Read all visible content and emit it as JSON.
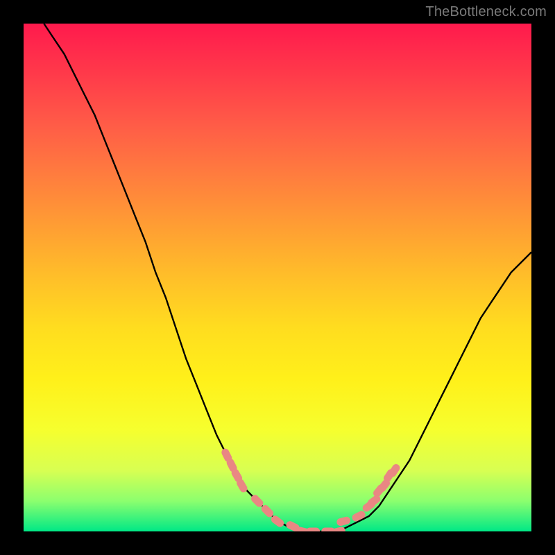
{
  "attribution": "TheBottleneck.com",
  "chart_data": {
    "type": "line",
    "title": "",
    "xlabel": "",
    "ylabel": "",
    "xlim": [
      0,
      100
    ],
    "ylim": [
      0,
      100
    ],
    "grid": false,
    "legend": false,
    "series": [
      {
        "name": "bottleneck-curve",
        "x": [
          4,
          6,
          8,
          10,
          12,
          14,
          16,
          18,
          20,
          22,
          24,
          26,
          28,
          30,
          32,
          34,
          36,
          38,
          40,
          42,
          44,
          46,
          48,
          50,
          52,
          54,
          56,
          58,
          60,
          62,
          64,
          66,
          68,
          70,
          72,
          74,
          76,
          78,
          80,
          82,
          84,
          86,
          88,
          90,
          92,
          94,
          96,
          98,
          100
        ],
        "y": [
          100,
          97,
          94,
          90,
          86,
          82,
          77,
          72,
          67,
          62,
          57,
          51,
          46,
          40,
          34,
          29,
          24,
          19,
          15,
          11,
          8,
          6,
          4,
          2,
          1,
          0,
          0,
          0,
          0,
          0,
          1,
          2,
          3,
          5,
          8,
          11,
          14,
          18,
          22,
          26,
          30,
          34,
          38,
          42,
          45,
          48,
          51,
          53,
          55
        ]
      }
    ],
    "markers": {
      "name": "sample-points",
      "color": "#e98783",
      "x": [
        40,
        41,
        42,
        43,
        46,
        48,
        50,
        53,
        55,
        57,
        60,
        62,
        63,
        66,
        68,
        69,
        70,
        71,
        72,
        73
      ],
      "y": [
        15,
        13,
        11,
        9,
        6,
        4,
        2,
        1,
        0,
        0,
        0,
        0,
        2,
        3,
        5,
        6,
        8,
        9,
        11,
        12
      ]
    }
  }
}
